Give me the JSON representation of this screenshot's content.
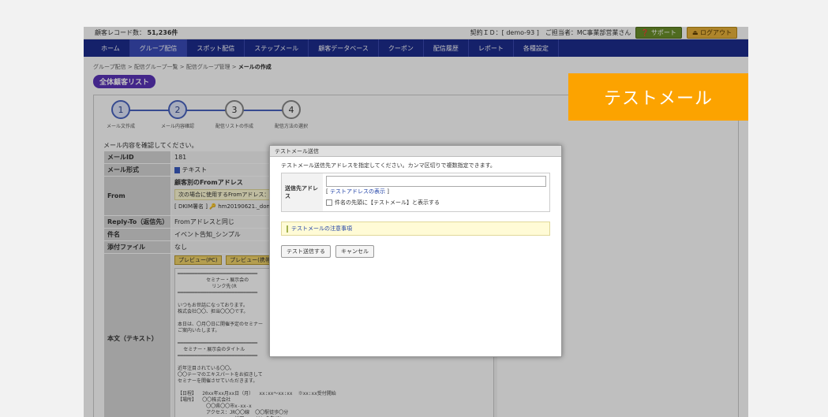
{
  "topbar": {
    "record_count": "顧客レコード数：",
    "record_value": "51,236件",
    "contract": "契約ＩＤ：[ demo-93 ]　ご担当者：MC事業部営業さん",
    "support_label": "サポート",
    "logout_label": "ログアウト"
  },
  "nav": {
    "items": [
      "ホーム",
      "グループ配信",
      "スポット配信",
      "ステップメール",
      "顧客データベース",
      "クーポン",
      "配信履歴",
      "レポート",
      "各種設定"
    ]
  },
  "breadcrumb": {
    "b1": "グループ配信",
    "b2": "配信グループ一覧",
    "b3": "配信グループ管理",
    "current": "メールの作成",
    "sep": ">"
  },
  "list_pill": "全体顧客リスト",
  "steps": {
    "s1": "1",
    "s2": "2",
    "s3": "3",
    "s4": "4",
    "l1": "メール文作成",
    "l2": "メール内容確認",
    "l3": "配信リストの作成",
    "l4": "配信方法の選択"
  },
  "confirm_text": "メール内容を確認してください。",
  "info": {
    "mail_id_label": "メールID",
    "mail_id": "181",
    "format_label": "メール形式",
    "format": "テキスト",
    "from_label": "From",
    "from_title": "顧客別のFromアドレス",
    "from_note": "次の場合に使用するFromアドレス：顧",
    "from_dkim": "[ DKIM署名 ]",
    "from_addr": "hm20190621._doma",
    "replyto_label": "Reply-To（返信先）",
    "replyto": "Fromアドレスと同じ",
    "subject_label": "件名",
    "subject": "イベント告知_シンプル",
    "attach_label": "添付ファイル",
    "attach": "なし",
    "body_label": "本文（テキスト）",
    "preview_pc": "プレビュー(PC)",
    "preview_mobile": "プレビュー(携帯)",
    "body_text": "━━━━━━━━━━━━━━━━━━━━━━━━━━━━\n          セミナー・展示会の\n            リンク先(R\n━━━━━━━━━━━━━━━━━━━━━━━━━━━━\n\nいつもお世話になっております。\n株式会社〇〇、担当〇〇〇です。\n\n本日は、〇月〇日に開催予定のセミナー\nご案内いたします。\n\n━━━━━━━━━━━━━━━━━━━━━━━━━━━━\n  セミナー・展示会のタイトル\n━━━━━━━━━━━━━━━━━━━━━━━━━━━━\n\n近年注目されている〇〇。\n〇〇テーマのエキスパートをお招きして\nセミナーを開催させていただきます。\n\n【日程】  20xx年xx月xx日（月）  xx:xx～xx:xx  ※xx:xx受付開始\n【場所】  〇〇株式会社\n          〇〇県〇〇市x-xx-x\n          アクセス：JR〇〇線  〇〇駅徒歩〇分\n                    地図 >> リンク先URL\n【費用】  〇〇円（事前のお振込みとなります）\n【主催】  株式会社〇〇"
  },
  "modal": {
    "title": "テストメール送信",
    "desc": "テストメール送信先アドレスを指定してください。カンマ区切りで複数指定できます。",
    "addr_label": "送信先アドレス",
    "addr_value": "",
    "addr_link_open": "[",
    "addr_link": "テストアドレスの表示",
    "addr_link_close": "]",
    "check_label": "件名の先頭に【テストメール】と表示する",
    "notice": "テストメールの注意事項",
    "send_button": "テスト送信する",
    "cancel_button": "キャンセル"
  },
  "badge": "テストメール",
  "colors": {
    "nav_bg": "#1d2c8e",
    "pill": "#5a33b8",
    "badge": "#fca300"
  }
}
